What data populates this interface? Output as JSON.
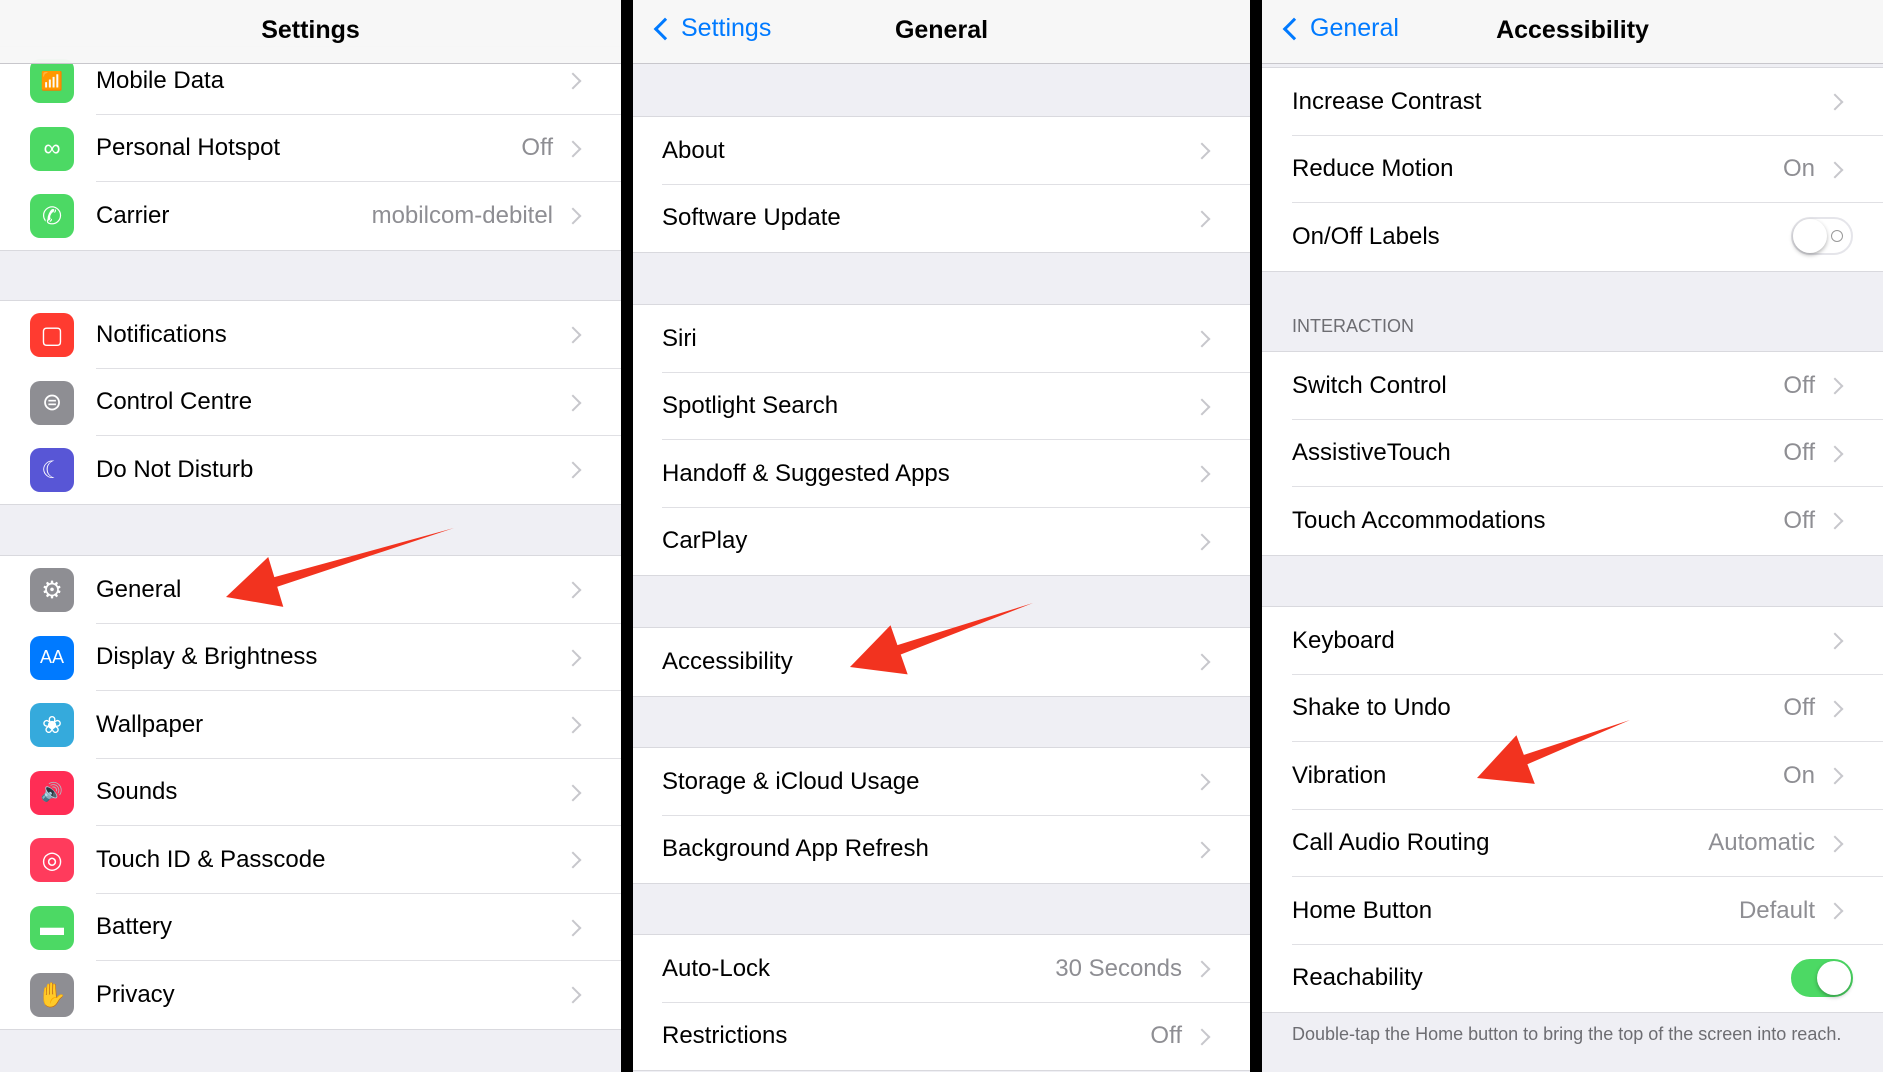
{
  "panels": [
    {
      "id": "settings",
      "title": "Settings",
      "back": null,
      "groups": [
        {
          "rows": [
            {
              "label": "Mobile Data",
              "icon": "antenna-icon",
              "icon_color": "#4cd964",
              "glyph": "📶"
            },
            {
              "label": "Personal Hotspot",
              "value": "Off",
              "icon": "hotspot-link-icon",
              "icon_color": "#4cd964",
              "glyph": "∞"
            },
            {
              "label": "Carrier",
              "value": "mobilcom-debitel",
              "icon": "phone-icon",
              "icon_color": "#4cd964",
              "glyph": "✆"
            }
          ]
        },
        {
          "rows": [
            {
              "label": "Notifications",
              "icon": "notifications-icon",
              "icon_color": "#ff3b30",
              "glyph": "▢"
            },
            {
              "label": "Control Centre",
              "icon": "control-centre-toggles-icon",
              "icon_color": "#8e8e93",
              "glyph": "⊜"
            },
            {
              "label": "Do Not Disturb",
              "icon": "moon-icon",
              "icon_color": "#5856d6",
              "glyph": "☾"
            }
          ]
        },
        {
          "rows": [
            {
              "label": "General",
              "icon": "gear-icon",
              "icon_color": "#8e8e93",
              "glyph": "⚙"
            },
            {
              "label": "Display & Brightness",
              "icon": "text-size-icon",
              "icon_color": "#007aff",
              "glyph": "AA"
            },
            {
              "label": "Wallpaper",
              "icon": "flower-icon",
              "icon_color": "#35aadc",
              "glyph": "❀"
            },
            {
              "label": "Sounds",
              "icon": "speaker-icon",
              "icon_color": "#ff2d55",
              "glyph": "🔊"
            },
            {
              "label": "Touch ID & Passcode",
              "icon": "fingerprint-icon",
              "icon_color": "#ff3b5c",
              "glyph": "◎"
            },
            {
              "label": "Battery",
              "icon": "battery-icon",
              "icon_color": "#4cd964",
              "glyph": "▬"
            },
            {
              "label": "Privacy",
              "icon": "hand-icon",
              "icon_color": "#8e8e93",
              "glyph": "✋"
            }
          ]
        }
      ]
    },
    {
      "id": "general",
      "title": "General",
      "back": "Settings",
      "groups": [
        {
          "rows": [
            {
              "label": "About"
            },
            {
              "label": "Software Update"
            }
          ]
        },
        {
          "rows": [
            {
              "label": "Siri"
            },
            {
              "label": "Spotlight Search"
            },
            {
              "label": "Handoff & Suggested Apps"
            },
            {
              "label": "CarPlay"
            }
          ]
        },
        {
          "rows": [
            {
              "label": "Accessibility"
            }
          ]
        },
        {
          "rows": [
            {
              "label": "Storage & iCloud Usage"
            },
            {
              "label": "Background App Refresh"
            }
          ]
        },
        {
          "rows": [
            {
              "label": "Auto-Lock",
              "value": "30 Seconds"
            },
            {
              "label": "Restrictions",
              "value": "Off"
            }
          ]
        }
      ]
    },
    {
      "id": "accessibility",
      "title": "Accessibility",
      "back": "General",
      "groups": [
        {
          "rows": [
            {
              "label": "Increase Contrast"
            },
            {
              "label": "Reduce Motion",
              "value": "On"
            },
            {
              "label": "On/Off Labels",
              "toggle": false
            }
          ]
        },
        {
          "header": "INTERACTION",
          "rows": [
            {
              "label": "Switch Control",
              "value": "Off"
            },
            {
              "label": "AssistiveTouch",
              "value": "Off"
            },
            {
              "label": "Touch Accommodations",
              "value": "Off"
            }
          ]
        },
        {
          "rows": [
            {
              "label": "Keyboard"
            },
            {
              "label": "Shake to Undo",
              "value": "Off"
            },
            {
              "label": "Vibration",
              "value": "On"
            },
            {
              "label": "Call Audio Routing",
              "value": "Automatic"
            },
            {
              "label": "Home Button",
              "value": "Default"
            },
            {
              "label": "Reachability",
              "toggle": true
            }
          ],
          "footer": "Double-tap the Home button to bring the top of the screen into reach."
        }
      ]
    }
  ],
  "colors": {
    "accent": "#007aff",
    "annotation_arrow": "#f2331f",
    "toggle_on": "#4cd964"
  }
}
